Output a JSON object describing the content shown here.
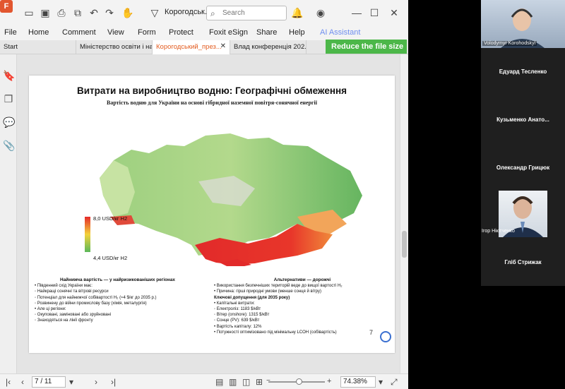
{
  "window": {
    "doc_title": "Корогодськ...",
    "search_placeholder": "Search",
    "menu": [
      "File",
      "Home",
      "Comment",
      "View",
      "Form",
      "Protect",
      "Foxit eSign",
      "Share",
      "Help",
      "AI Assistant"
    ],
    "tabs": [
      {
        "label": "Start",
        "active": false
      },
      {
        "label": "Міністерство освіти і на...",
        "active": false
      },
      {
        "label": "Корогодський_през...",
        "active": true
      },
      {
        "label": "Влад  конференція 202...",
        "active": false
      }
    ],
    "reduce_button": "Reduce the file size"
  },
  "slide": {
    "title": "Витрати на виробництво водню: Географічні обмеження",
    "subtitle": "Вартість водню для України на основі гібридної наземної повітря-сонячної енергії",
    "legend_max": "8,0 USD/кг H2",
    "legend_min": "4,4 USD/кг H2",
    "left_col": {
      "heading": "Найнижча вартість — у найризикованіших регіонах",
      "lines": [
        "•  Південний схід України має:",
        "      ◦  Найкращі сонячні та вітрові ресурси",
        "      ◦  Потенціал для найнижчої собівартості H₂ (≈4 $/кг до 2035 р.)",
        "      ◦  Розвинену до війни промислову базу (хімія, металургія)",
        "•  Але ці регіони:",
        "      ◦  Окуповані, заміновані або зруйновані",
        "      ◦  Знаходяться на лінії фронту"
      ]
    },
    "right_col": {
      "heading": "Альтернативи — дорожчі",
      "lines": [
        "•  Використання безпечніших територій веде до вищої вартості H₂",
        "•  Причина: гіршi природні умови (менше сонця й вітру)",
        "                 Ключові допущення (для 2035 року)",
        "•  Капітальні витрати:",
        "      ◦  Електроліз: 1183 $/кВт",
        "      ◦  Вітер (onshore): 1315 $/кВт",
        "      ◦  Сонце (PV): 639 $/кВт",
        "•  Вартість капіталу: 12%",
        "•  Потужності оптимізовано під мінімальну LCOH (собівартість)"
      ]
    },
    "page_number": "7"
  },
  "statusbar": {
    "page": "7 / 11",
    "zoom": "74.38%"
  },
  "conference": {
    "top_cam_label": "Volodymyr Korohodskyi",
    "participants": [
      "Едуард Тесленко",
      "Кузьменко  Анато...",
      "Олександр Грицюк"
    ],
    "mid_cam_label": "Ігор Нікітченко",
    "last_participant": "Гліб Стрижак"
  }
}
